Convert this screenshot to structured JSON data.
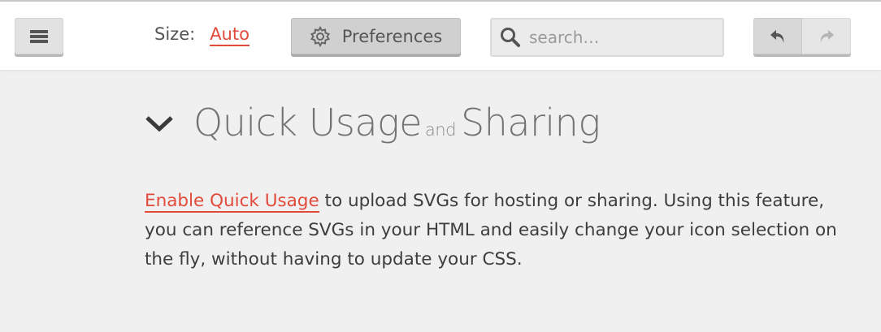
{
  "toolbar": {
    "menu_icon": "hamburger-icon",
    "size_label": "Size:",
    "size_value": "Auto",
    "preferences_label": "Preferences",
    "preferences_icon": "gear-icon",
    "search_placeholder": "search…",
    "search_icon": "search-icon",
    "undo_icon": "undo-icon",
    "redo_icon": "redo-icon"
  },
  "section": {
    "title_part1": "Quick Usage",
    "title_and": "and",
    "title_part2": "Sharing",
    "toggle_icon": "chevron-down-icon",
    "link_text": "Enable Quick Usage",
    "body_text": " to upload SVGs for hosting or sharing. Using this feature, you can reference SVGs in your HTML and easily change your icon selection on the fly, without having to update your CSS."
  },
  "colors": {
    "accent": "#e24a3b",
    "background": "#f0f0f0",
    "toolbar": "#ffffff"
  }
}
